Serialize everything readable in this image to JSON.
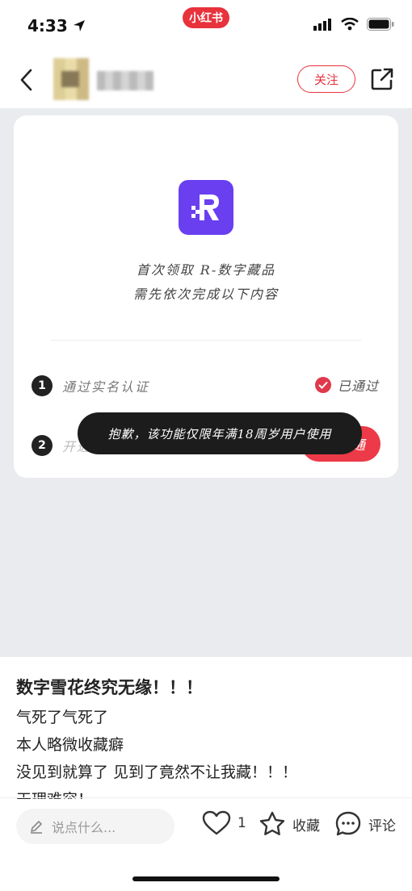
{
  "status_bar": {
    "time": "4:33",
    "app_badge": "小红书"
  },
  "header": {
    "follow_label": "关注"
  },
  "card": {
    "intro_line1": "首次领取 R-数字藏品",
    "intro_line2": "需先依次完成以下内容",
    "steps": [
      {
        "number": "1",
        "label": "通过实名认证",
        "status": "已通过"
      },
      {
        "number": "2",
        "label": "开通数字藏品账户",
        "button": "开通"
      }
    ],
    "toast": "抱歉，该功能仅限年满18周岁用户使用",
    "logo_color": "#6a3ff0",
    "accent_color": "#ec3a48"
  },
  "post": {
    "title": "数字雪花终究无缘！！！",
    "lines": [
      "气死了气死了",
      "本人略微收藏癖",
      "没见到就算了 见到了竟然不让我藏！！！",
      "天理难容！"
    ]
  },
  "bottom_bar": {
    "comment_placeholder": "说点什么...",
    "like_count": "1",
    "favorite_label": "收藏",
    "comment_label": "评论"
  },
  "icons": [
    "location-arrow-icon",
    "signal-icon",
    "wifi-icon",
    "battery-icon",
    "back-icon",
    "share-icon",
    "check-icon",
    "pencil-icon",
    "heart-icon",
    "star-icon",
    "comment-icon"
  ]
}
